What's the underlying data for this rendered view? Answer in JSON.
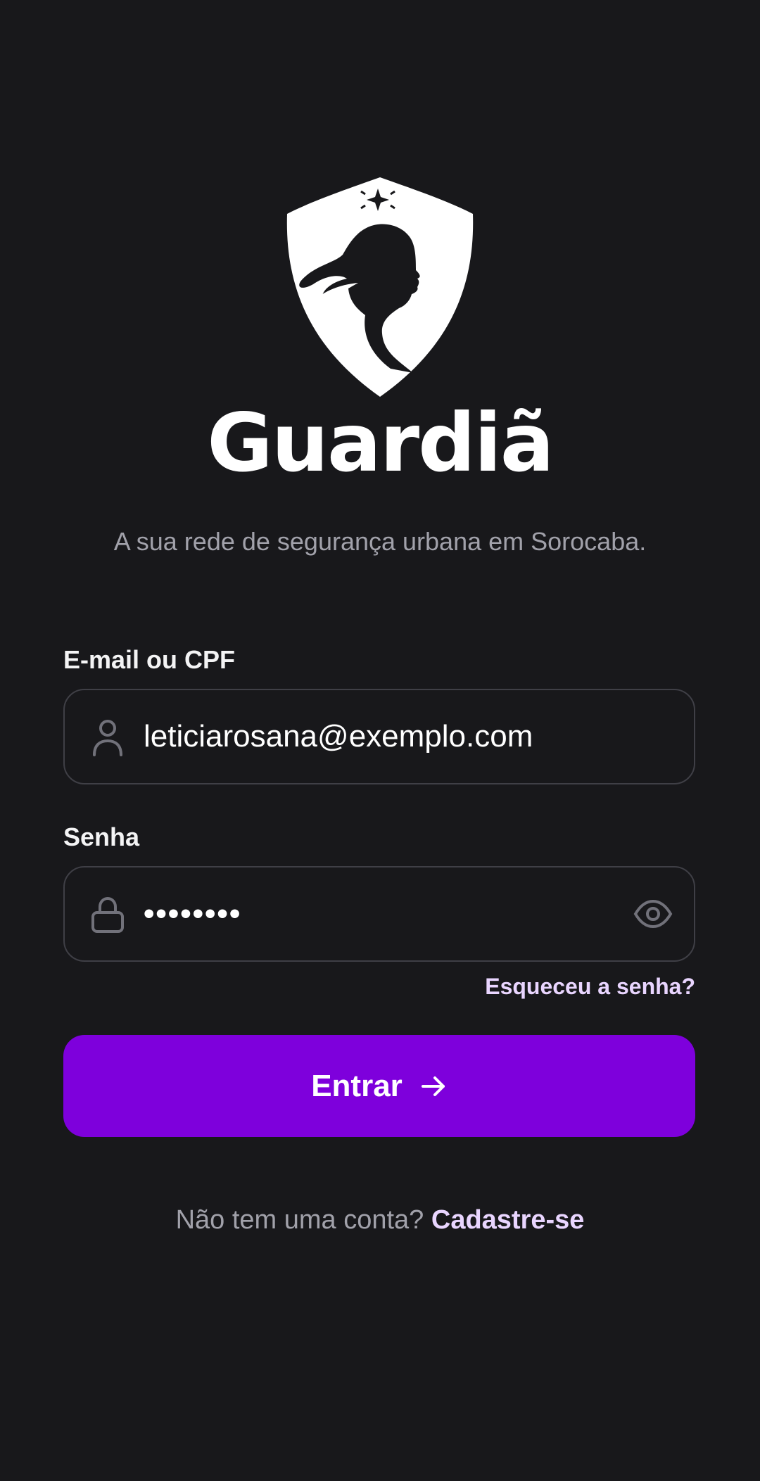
{
  "brand": {
    "name": "Guardiã",
    "tagline": "A sua rede de segurança urbana em Sorocaba."
  },
  "login": {
    "email_label": "E-mail ou CPF",
    "email_value": "leticiarosana@exemplo.com",
    "password_label": "Senha",
    "password_value": "••••••••",
    "forgot_link": "Esqueceu a senha?",
    "submit_label": "Entrar",
    "signup_prompt": "Não tem uma conta?",
    "signup_link": "Cadastre-se"
  },
  "icons": {
    "logo": "shield-woman-logo-icon",
    "email": "user-icon",
    "password": "lock-icon",
    "toggle_visibility": "eye-icon",
    "submit": "arrow-right-icon"
  },
  "colors": {
    "background": "#18181b",
    "accent": "#7e00dc",
    "link": "#e9d5ff",
    "muted_text": "#a1a1aa",
    "border": "#3f3f46"
  }
}
